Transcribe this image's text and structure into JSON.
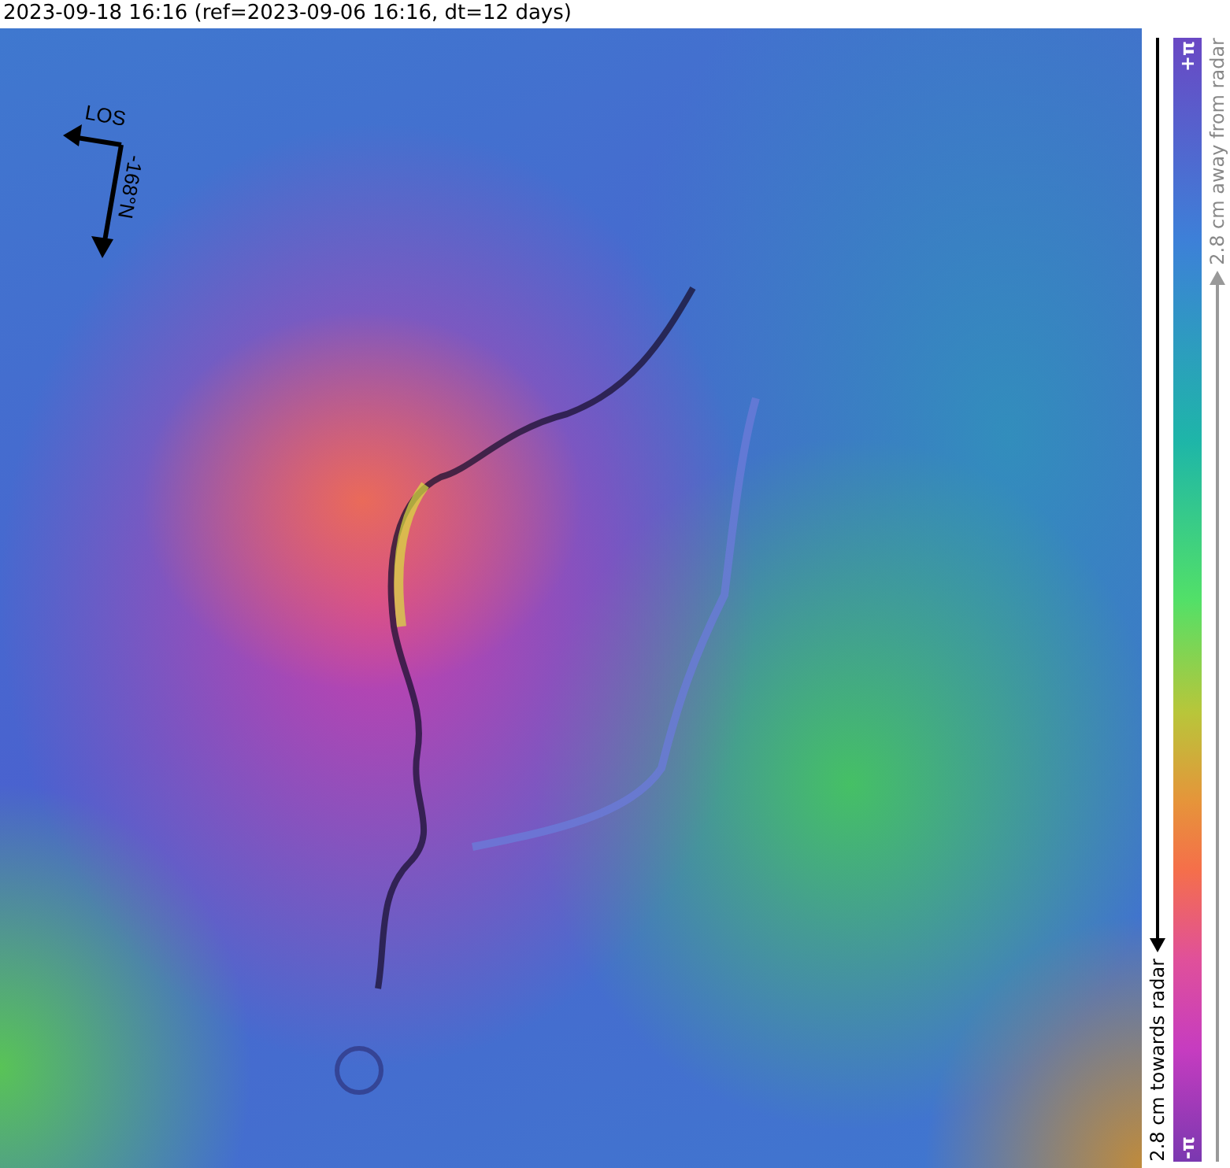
{
  "title": "2023-09-18 16:16 (ref=2023-09-06 16:16, dt=12 days)",
  "map": {
    "los_label": "LOS",
    "heading_label": "-168°N"
  },
  "colorbar": {
    "max_label": "+π",
    "min_label": "-π",
    "towards_label": "2.8 cm towards radar",
    "away_label": "2.8 cm away from radar"
  }
}
